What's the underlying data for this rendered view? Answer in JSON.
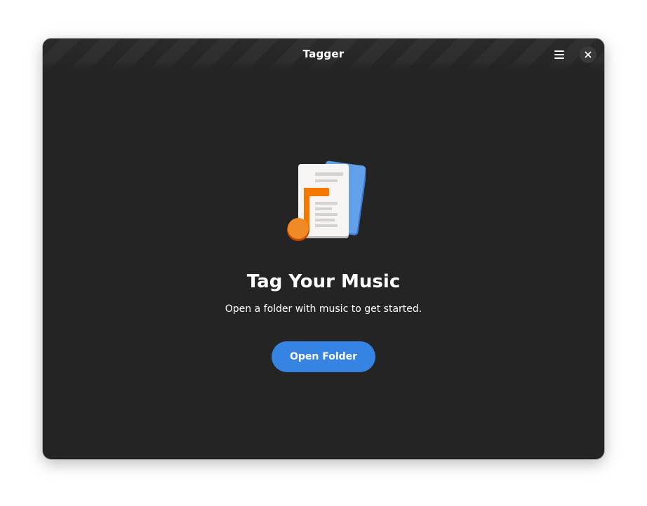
{
  "window": {
    "title": "Tagger"
  },
  "headerbar": {
    "menu_icon": "hamburger-menu-icon",
    "close_icon": "close-icon"
  },
  "status_page": {
    "icon": "music-document-icon",
    "heading": "Tag Your Music",
    "description": "Open a folder with music to get started.",
    "button_label": "Open Folder"
  },
  "colors": {
    "window_bg": "#242424",
    "accent": "#3584e4",
    "icon_orange": "#f57900",
    "icon_blue": "#62a0ea"
  }
}
